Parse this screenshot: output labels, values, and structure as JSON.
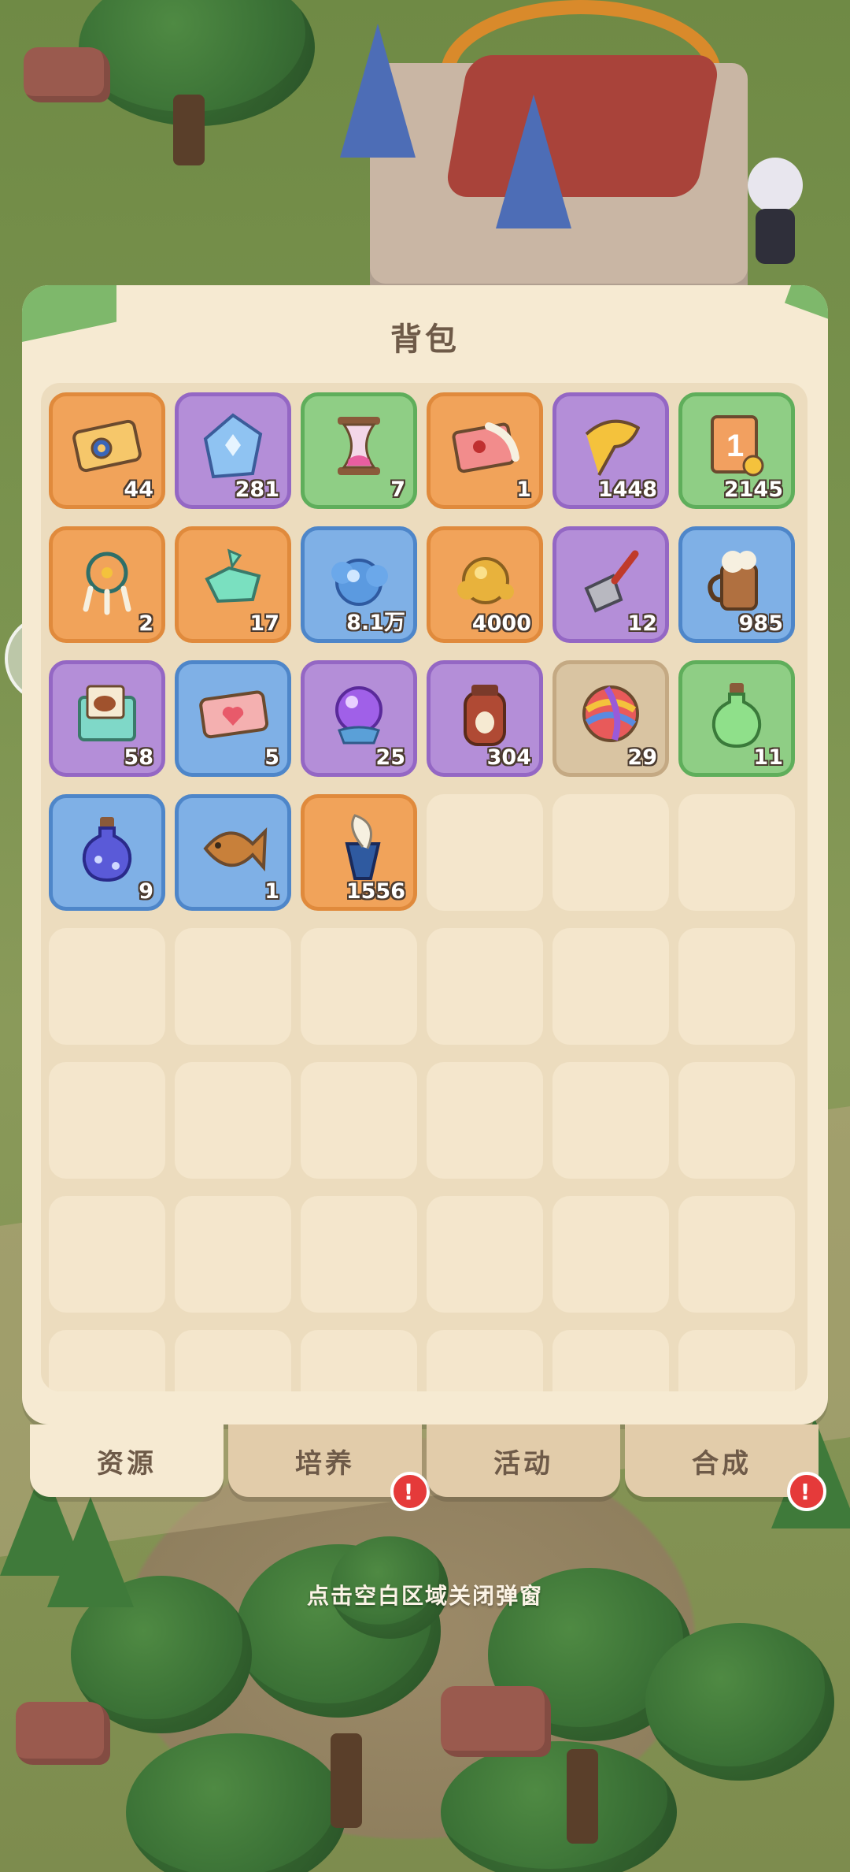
{
  "panel": {
    "title": "背包"
  },
  "items": [
    {
      "name": "ticket-card-icon",
      "rarity": "orange",
      "count": "44"
    },
    {
      "name": "crystal-icon",
      "rarity": "purple",
      "count": "281"
    },
    {
      "name": "hourglass-icon",
      "rarity": "green",
      "count": "7"
    },
    {
      "name": "letter-feather-icon",
      "rarity": "orange",
      "count": "1"
    },
    {
      "name": "ginkgo-leaf-icon",
      "rarity": "purple",
      "count": "1448"
    },
    {
      "name": "card-pack-icon",
      "rarity": "green",
      "count": "2145"
    },
    {
      "name": "dreamcatcher-icon",
      "rarity": "orange",
      "count": "2"
    },
    {
      "name": "jade-shard-icon",
      "rarity": "orange",
      "count": "17"
    },
    {
      "name": "blue-cloud-orb-icon",
      "rarity": "blue",
      "count": "8.1万"
    },
    {
      "name": "gold-nugget-icon",
      "rarity": "orange",
      "count": "4000"
    },
    {
      "name": "shovel-icon",
      "rarity": "purple",
      "count": "12"
    },
    {
      "name": "beer-mug-icon",
      "rarity": "blue",
      "count": "985"
    },
    {
      "name": "food-letter-icon",
      "rarity": "purple",
      "count": "58"
    },
    {
      "name": "heart-ticket-icon",
      "rarity": "blue",
      "count": "5"
    },
    {
      "name": "crystal-ball-icon",
      "rarity": "purple",
      "count": "25"
    },
    {
      "name": "honey-jar-icon",
      "rarity": "purple",
      "count": "304"
    },
    {
      "name": "yarn-ball-icon",
      "rarity": "tan",
      "count": "29"
    },
    {
      "name": "green-potion-icon",
      "rarity": "green",
      "count": "11"
    },
    {
      "name": "blue-potion-icon",
      "rarity": "blue",
      "count": "9"
    },
    {
      "name": "wooden-fish-icon",
      "rarity": "blue",
      "count": "1"
    },
    {
      "name": "quill-ink-icon",
      "rarity": "orange",
      "count": "1556"
    }
  ],
  "empty_slots": 27,
  "tabs": [
    {
      "label": "资源",
      "active": true,
      "badge": false
    },
    {
      "label": "培养",
      "active": false,
      "badge": true
    },
    {
      "label": "活动",
      "active": false,
      "badge": false
    },
    {
      "label": "合成",
      "active": false,
      "badge": true
    }
  ],
  "badge_symbol": "!",
  "hint": "点击空白区域关闭弹窗",
  "colors": {
    "orange": "#f1a35a",
    "purple": "#b48ed8",
    "green": "#8fce85",
    "blue": "#7fb0e6",
    "tan": "#d9c4a2",
    "panel": "#f6ead2",
    "tab": "#e2ccaa",
    "badge": "#e53a3a"
  }
}
